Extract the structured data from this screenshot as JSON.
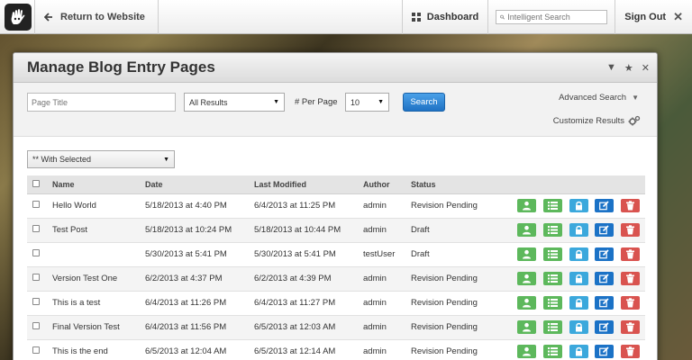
{
  "topbar": {
    "return_label": "Return to Website",
    "dashboard_label": "Dashboard",
    "search_placeholder": "Intelligent Search",
    "signout_label": "Sign Out",
    "signout_x": "✕"
  },
  "dialog": {
    "title": "Manage Blog Entry Pages",
    "ctrl": {
      "collapse": "▼",
      "star": "★",
      "close": "✕"
    }
  },
  "filters": {
    "page_title_placeholder": "Page Title",
    "results_value": "All Results",
    "per_page_label": "# Per Page",
    "per_page_value": "10",
    "search_button": "Search",
    "advanced_search": "Advanced Search",
    "customize_results": "Customize Results"
  },
  "with_selected": "** With Selected",
  "table": {
    "headers": {
      "name": "Name",
      "date": "Date",
      "modified": "Last Modified",
      "author": "Author",
      "status": "Status"
    },
    "rows": [
      {
        "name": "Hello World",
        "date": "5/18/2013 at 4:40 PM",
        "modified": "6/4/2013 at 11:25 PM",
        "author": "admin",
        "status": "Revision Pending"
      },
      {
        "name": "Test Post",
        "date": "5/18/2013 at 10:24 PM",
        "modified": "5/18/2013 at 10:44 PM",
        "author": "admin",
        "status": "Draft"
      },
      {
        "name": "",
        "date": "5/30/2013 at 5:41 PM",
        "modified": "5/30/2013 at 5:41 PM",
        "author": "testUser",
        "status": "Draft"
      },
      {
        "name": "Version Test One",
        "date": "6/2/2013 at 4:37 PM",
        "modified": "6/2/2013 at 4:39 PM",
        "author": "admin",
        "status": "Revision Pending"
      },
      {
        "name": "This is a test",
        "date": "6/4/2013 at 11:26 PM",
        "modified": "6/4/2013 at 11:27 PM",
        "author": "admin",
        "status": "Revision Pending"
      },
      {
        "name": "Final Version Test",
        "date": "6/4/2013 at 11:56 PM",
        "modified": "6/5/2013 at 12:03 AM",
        "author": "admin",
        "status": "Revision Pending"
      },
      {
        "name": "This is the end",
        "date": "6/5/2013 at 12:04 AM",
        "modified": "6/5/2013 at 12:14 AM",
        "author": "admin",
        "status": "Revision Pending"
      }
    ]
  },
  "colors": {
    "accent_blue": "#1f72c4",
    "action_green": "#5db85c",
    "action_light_blue": "#3ba8dc",
    "action_dark_blue": "#1b72c6",
    "action_red": "#d9534f"
  }
}
